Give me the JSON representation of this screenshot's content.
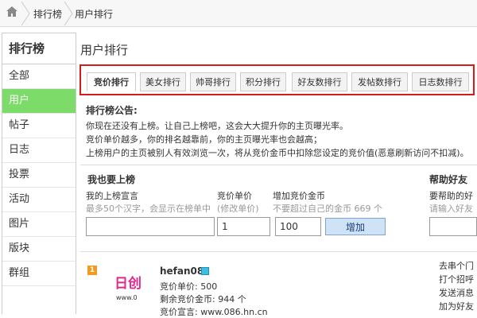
{
  "breadcrumb": {
    "items": [
      "排行榜",
      "用户排行"
    ]
  },
  "sidebar": {
    "title": "排行榜",
    "items": [
      {
        "label": "全部"
      },
      {
        "label": "用户"
      },
      {
        "label": "帖子"
      },
      {
        "label": "日志"
      },
      {
        "label": "投票"
      },
      {
        "label": "活动"
      },
      {
        "label": "图片"
      },
      {
        "label": "版块"
      },
      {
        "label": "群组"
      }
    ],
    "active_index": 1
  },
  "main": {
    "title": "用户排行",
    "tabs": [
      {
        "label": "竞价排行"
      },
      {
        "label": "美女排行"
      },
      {
        "label": "帅哥排行"
      },
      {
        "label": "积分排行"
      },
      {
        "label": "好友数排行"
      },
      {
        "label": "发帖数排行"
      },
      {
        "label": "日志数排行"
      }
    ],
    "notice": {
      "title": "排行榜公告:",
      "lines": [
        "你现在还没有上榜。让自己上榜吧，这会大大提升你的主页曝光率。",
        "竞价单价越多，你的排名越靠前，你的主页曝光率也会越高；",
        "上榜用户的主页被别人有效浏览一次，将从竞价金币中扣除您设定的竞价值(恶意刷新访问不扣减)。"
      ]
    },
    "bid_form": {
      "title": "我也要上榜",
      "slogan_label": "我的上榜宣言",
      "slogan_hint": "最多50个汉字，会显示在榜单中",
      "slogan_value": "",
      "price_label": "竞价单价",
      "price_hint": "(修改单价)",
      "price_value": "1",
      "add_label": "增加竞价金币",
      "add_hint": "不要超过自己的金币 669 个",
      "add_value": "100",
      "add_button": "增加"
    },
    "help_friend": {
      "title": "帮助好友",
      "label": "要帮助的好",
      "hint": "请输入好友"
    },
    "user_entry": {
      "rank": "1",
      "name": "hefan08",
      "price": "竞价单价: 500",
      "remaining": "剩余竞价金币: 944 个",
      "slogan": "竞价宣言: www.086.hn.cn",
      "avatar_text": "日创",
      "avatar_sub": "www.0"
    },
    "right_links": [
      "去串个门",
      "打个招呼",
      "发送消息",
      "加为好友"
    ]
  },
  "colors": {
    "tab_highlight_border": "#d71a1a",
    "sidebar_active": "#7ddb6a",
    "rank_badge": "#f39a21",
    "verify_icon": "#3fbde7"
  }
}
